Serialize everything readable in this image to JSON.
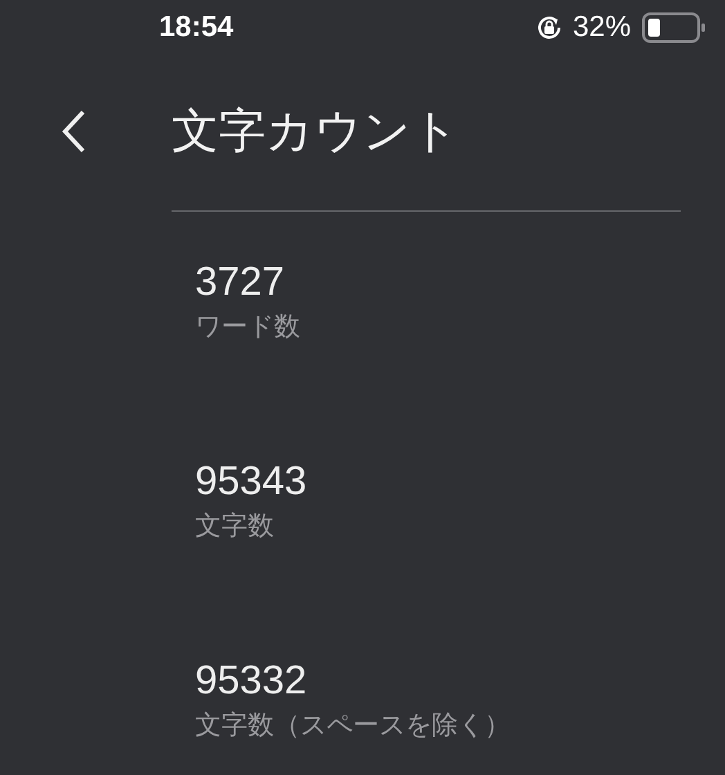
{
  "status_bar": {
    "time": "18:54",
    "battery": "32%"
  },
  "header": {
    "title": "文字カウント"
  },
  "stats": [
    {
      "value": "3727",
      "label": "ワード数"
    },
    {
      "value": "95343",
      "label": "文字数"
    },
    {
      "value": "95332",
      "label": "文字数（スペースを除く）"
    }
  ]
}
